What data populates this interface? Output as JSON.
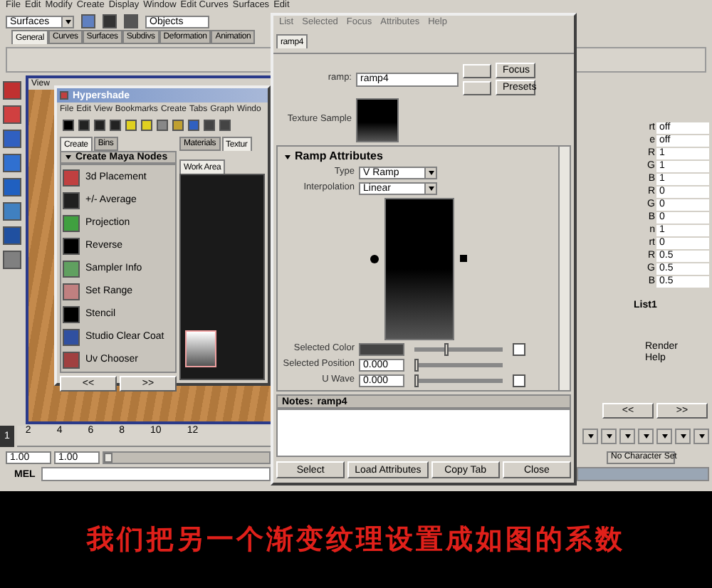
{
  "main_menu": [
    "File",
    "Edit",
    "Modify",
    "Create",
    "Display",
    "Window",
    "Edit Curves",
    "Surfaces",
    "Edit"
  ],
  "toolbar": {
    "menu_set": "Surfaces",
    "selection_field": "Objects"
  },
  "shelf_tabs": [
    {
      "label": "General",
      "selected": true
    },
    {
      "label": "Curves",
      "selected": false
    },
    {
      "label": "Surfaces",
      "selected": false
    },
    {
      "label": "Subdivs",
      "selected": false
    },
    {
      "label": "Deformation",
      "selected": false
    },
    {
      "label": "Animation",
      "selected": false
    }
  ],
  "viewport": {
    "menu": "View"
  },
  "hypershade": {
    "title": "Hypershade",
    "menu": [
      "File",
      "Edit",
      "View",
      "Bookmarks",
      "Create",
      "Tabs",
      "Graph",
      "Windo"
    ],
    "left_tabs": [
      {
        "label": "Create",
        "selected": true
      },
      {
        "label": "Bins",
        "selected": false
      }
    ],
    "section": "Create Maya Nodes",
    "nodes": [
      {
        "label": "3d Placement"
      },
      {
        "label": "+/- Average"
      },
      {
        "label": "Projection"
      },
      {
        "label": "Reverse"
      },
      {
        "label": "Sampler Info"
      },
      {
        "label": "Set Range"
      },
      {
        "label": "Stencil"
      },
      {
        "label": "Studio Clear Coat"
      },
      {
        "label": "Uv Chooser"
      }
    ],
    "nav": [
      "<<",
      ">>"
    ],
    "right_tabs": [
      {
        "label": "Materials",
        "selected": false
      },
      {
        "label": "Textur",
        "selected": true
      }
    ],
    "work_tab": "Work Area"
  },
  "attribute_editor": {
    "menu": [
      "List",
      "Selected",
      "Focus",
      "Attributes",
      "Help"
    ],
    "tab": "ramp4",
    "name_label": "ramp:",
    "name_value": "ramp4",
    "buttons": [
      "Focus",
      "Presets"
    ],
    "sample_label": "Texture Sample",
    "section": "Ramp Attributes",
    "type_label": "Type",
    "type_value": "V Ramp",
    "interp_label": "Interpolation",
    "interp_value": "Linear",
    "rows": [
      {
        "label": "Selected Color",
        "kind": "color",
        "level": 0.35
      },
      {
        "label": "Selected Position",
        "kind": "number",
        "value": "0.000",
        "level": 0
      },
      {
        "label": "U Wave",
        "kind": "number",
        "value": "0.000",
        "level": 0
      }
    ],
    "notes_label": "Notes:",
    "notes_value": "ramp4",
    "footer": [
      "Select",
      "Load Attributes",
      "Copy Tab",
      "Close"
    ]
  },
  "channel_box": {
    "rows": [
      {
        "label": "rt",
        "value": "off"
      },
      {
        "label": "e",
        "value": "off"
      },
      {
        "label": "R",
        "value": "1"
      },
      {
        "label": "G",
        "value": "1"
      },
      {
        "label": "B",
        "value": "1"
      },
      {
        "label": "R",
        "value": "0"
      },
      {
        "label": "G",
        "value": "0"
      },
      {
        "label": "B",
        "value": "0"
      },
      {
        "label": "n",
        "value": "1"
      },
      {
        "label": "rt",
        "value": "0"
      },
      {
        "label": "R",
        "value": "0.5"
      },
      {
        "label": "G",
        "value": "0.5"
      },
      {
        "label": "B",
        "value": "0.5"
      }
    ],
    "node": "List1",
    "menu": [
      "Render",
      "Help"
    ],
    "nav": [
      "<<",
      ">>"
    ]
  },
  "timeline": {
    "ticks": [
      "2",
      "4",
      "6",
      "8",
      "10",
      "12"
    ],
    "current": "1",
    "start": "1.00",
    "end": "1.00",
    "range": {
      "level": 0
    },
    "character_set": "No Character Set",
    "mel_label": "MEL"
  },
  "caption": "我们把另一个渐变纹理设置成如图的系数"
}
